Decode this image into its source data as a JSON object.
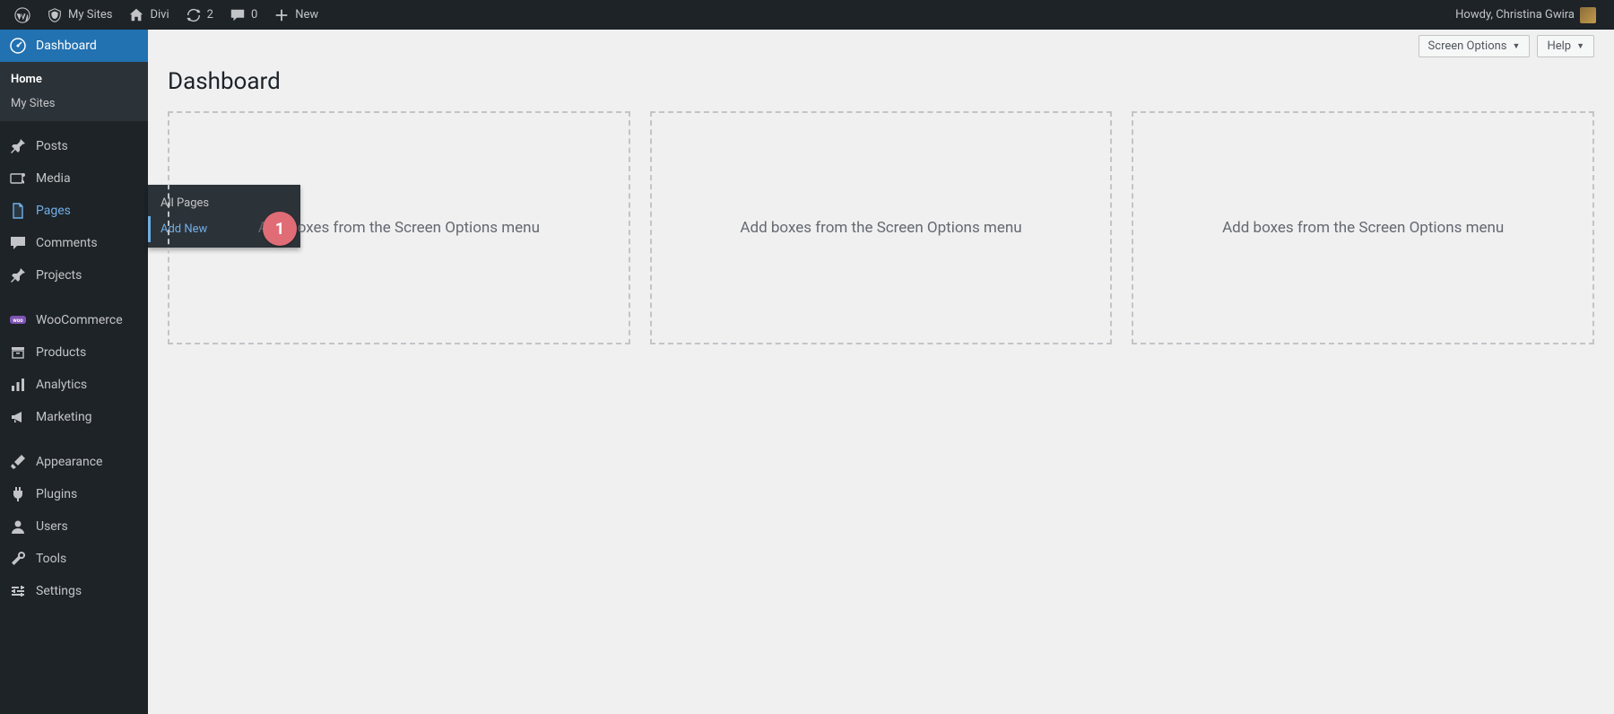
{
  "adminbar": {
    "my_sites": "My Sites",
    "site_name": "Divi",
    "refresh_count": "2",
    "comments_count": "0",
    "new_label": "New",
    "howdy": "Howdy, Christina Gwira"
  },
  "sidebar": {
    "dashboard": {
      "label": "Dashboard",
      "submenu": [
        "Home",
        "My Sites"
      ],
      "active_sub": 0
    },
    "items": [
      {
        "label": "Posts",
        "icon": "pin"
      },
      {
        "label": "Media",
        "icon": "media"
      },
      {
        "label": "Pages",
        "icon": "page"
      },
      {
        "label": "Comments",
        "icon": "comment"
      },
      {
        "label": "Projects",
        "icon": "pin"
      }
    ],
    "items2": [
      {
        "label": "WooCommerce",
        "icon": "woo"
      },
      {
        "label": "Products",
        "icon": "archive"
      },
      {
        "label": "Analytics",
        "icon": "chart"
      },
      {
        "label": "Marketing",
        "icon": "megaphone"
      }
    ],
    "items3": [
      {
        "label": "Appearance",
        "icon": "brush"
      },
      {
        "label": "Plugins",
        "icon": "plug"
      },
      {
        "label": "Users",
        "icon": "user"
      },
      {
        "label": "Tools",
        "icon": "wrench"
      },
      {
        "label": "Settings",
        "icon": "sliders"
      }
    ],
    "pages_flyout": [
      "All Pages",
      "Add New"
    ],
    "pages_flyout_hover": 1
  },
  "top_controls": {
    "screen_options": "Screen Options",
    "help": "Help"
  },
  "page_title": "Dashboard",
  "placeholder_text": "Add boxes from the Screen Options menu",
  "badge": "1"
}
